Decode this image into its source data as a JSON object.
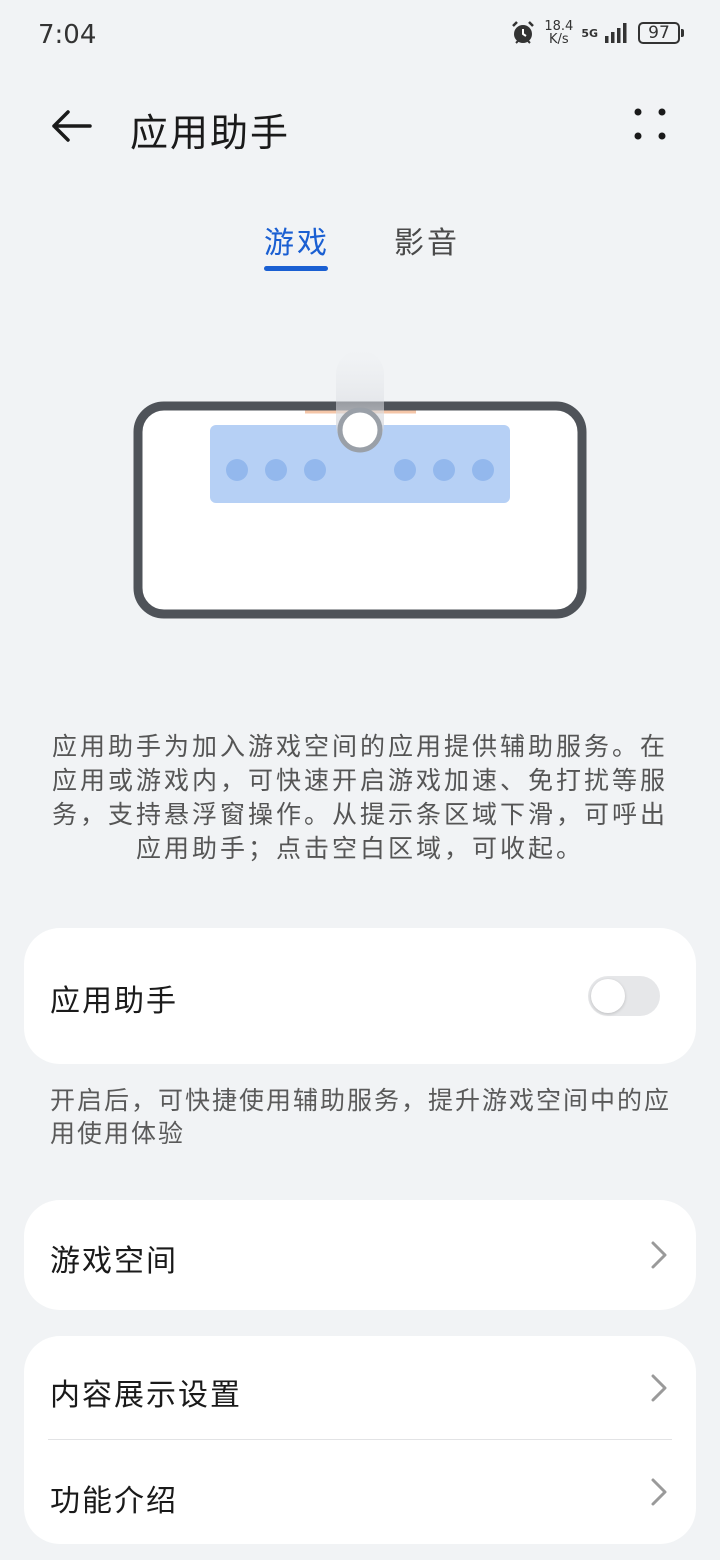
{
  "status_bar": {
    "time": "7:04",
    "speed_value": "18.4",
    "speed_unit": "K/s",
    "network": "5G",
    "battery": "97",
    "icons": [
      "alarm-icon",
      "signal-icon",
      "battery-icon"
    ]
  },
  "header": {
    "title": "应用助手",
    "back_icon": "arrow-left-icon",
    "more_icon": "more-dots-icon"
  },
  "tabs": [
    {
      "label": "游戏",
      "active": true
    },
    {
      "label": "影音",
      "active": false
    }
  ],
  "description": "应用助手为加入游戏空间的应用提供辅助服务。在应用或游戏内，可快速开启游戏加速、免打扰等服务，支持悬浮窗操作。从提示条区域下滑，可呼出应用助手；点击空白区域，可收起。",
  "assistant_card": {
    "label": "应用助手",
    "toggle_on": false
  },
  "assistant_hint": "开启后，可快捷使用辅助服务，提升游戏空间中的应用使用体验",
  "list_items": [
    {
      "label": "游戏空间",
      "icon": "chevron-right-icon"
    },
    {
      "label": "内容展示设置",
      "icon": "chevron-right-icon"
    },
    {
      "label": "功能介绍",
      "icon": "chevron-right-icon"
    }
  ],
  "colors": {
    "accent": "#1a5fd2",
    "background": "#f1f3f5",
    "card": "#ffffff",
    "illustration_panel": "#b6d0f5",
    "illustration_dot": "#93b8ed"
  }
}
